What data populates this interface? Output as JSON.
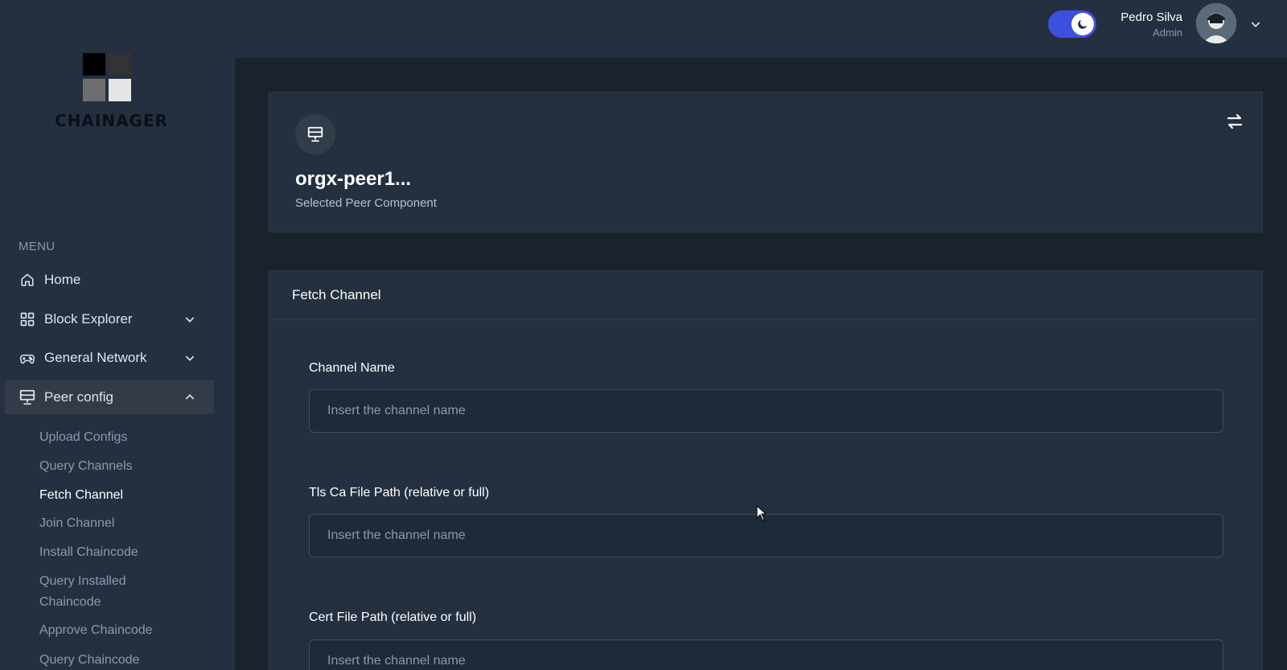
{
  "brand": {
    "name": "CHAINAGER"
  },
  "sidebar": {
    "menu_title": "MENU",
    "items": [
      {
        "label": "Home",
        "icon": "home-icon"
      },
      {
        "label": "Block Explorer",
        "icon": "grid-icon"
      },
      {
        "label": "General Network",
        "icon": "gamepad-icon"
      },
      {
        "label": "Peer config",
        "icon": "monitor-icon"
      }
    ],
    "sub_items": [
      {
        "label": "Upload Configs"
      },
      {
        "label": "Query Channels"
      },
      {
        "label": "Fetch Channel"
      },
      {
        "label": "Join Channel"
      },
      {
        "label": "Install Chaincode"
      },
      {
        "label": "Query Installed Chaincode"
      },
      {
        "label": "Approve Chaincode"
      },
      {
        "label": "Query Chaincode"
      }
    ]
  },
  "header": {
    "user_name": "Pedro Silva",
    "user_role": "Admin",
    "dark_mode": true
  },
  "peer_card": {
    "title": "orgx-peer1...",
    "subtitle": "Selected Peer Component"
  },
  "form": {
    "title": "Fetch Channel",
    "fields": [
      {
        "label": "Channel Name",
        "placeholder": "Insert the channel name",
        "value": ""
      },
      {
        "label": "Tls Ca File Path (relative or full)",
        "placeholder": "Insert the channel name",
        "value": ""
      },
      {
        "label": "Cert File Path (relative or full)",
        "placeholder": "Insert the channel name",
        "value": ""
      }
    ]
  },
  "colors": {
    "accent": "#3c50e0",
    "sidebar_bg": "#24303f",
    "main_bg": "#1a222c",
    "card_bg": "#24303f"
  }
}
